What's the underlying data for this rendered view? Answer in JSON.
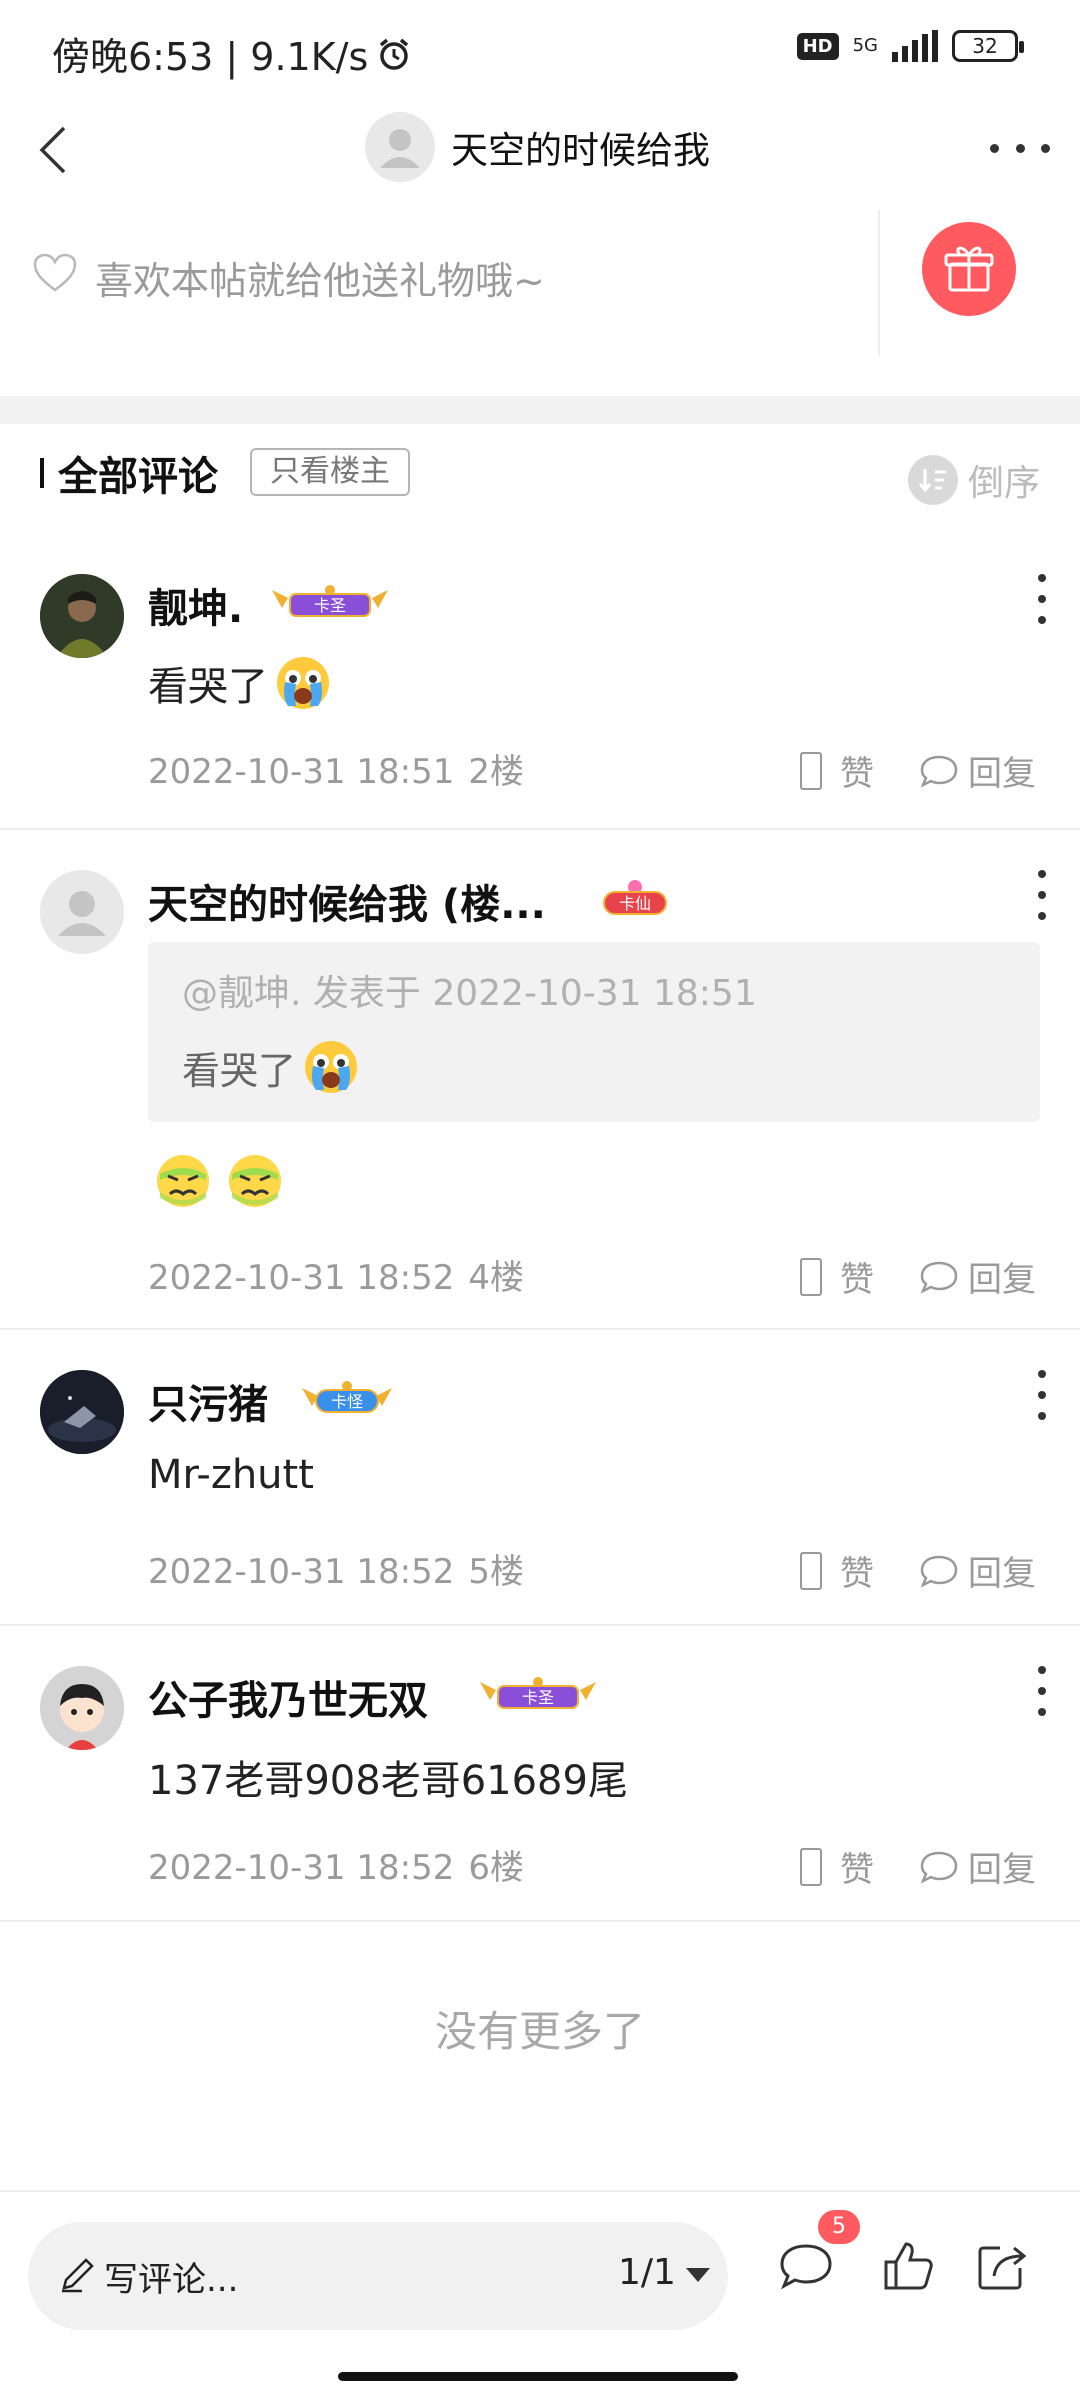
{
  "status_bar": {
    "time_speed": "傍晚6:53 | 9.1K/s",
    "hd": "HD",
    "network": "5G",
    "battery": "32"
  },
  "header": {
    "title": "天空的时候给我"
  },
  "gift": {
    "prompt": "喜欢本帖就给他送礼物哦~"
  },
  "comments_header": {
    "title": "全部评论",
    "op_only": "只看楼主",
    "sort": "倒序"
  },
  "comments": [
    {
      "name": "靓坤.",
      "badge": "卡圣",
      "text": "看哭了",
      "date": "2022-10-31 18:51",
      "floor": "2楼",
      "like": "赞",
      "reply": "回复"
    },
    {
      "name": "天空的时候给我 (楼...",
      "badge": "卡仙",
      "quote_meta": "@靓坤. 发表于 2022-10-31 18:51",
      "quote_text": "看哭了",
      "date": "2022-10-31 18:52",
      "floor": "4楼",
      "like": "赞",
      "reply": "回复"
    },
    {
      "name": "只污猪",
      "badge": "卡怪",
      "text": "Mr-zhutt",
      "date": "2022-10-31 18:52",
      "floor": "5楼",
      "like": "赞",
      "reply": "回复"
    },
    {
      "name": "公子我乃世无双",
      "badge": "卡圣",
      "text": "137老哥908老哥61689尾",
      "date": "2022-10-31 18:52",
      "floor": "6楼",
      "like": "赞",
      "reply": "回复"
    }
  ],
  "footer": {
    "no_more": "没有更多了"
  },
  "bottom_bar": {
    "write_placeholder": "写评论...",
    "page": "1/1",
    "comment_count": "5"
  },
  "colors": {
    "accent_red": "#ff5a5f",
    "badge_purple": "#8a4fd8",
    "badge_blue": "#3a8fe8",
    "badge_red": "#e8424a",
    "gold": "#f0b030"
  }
}
